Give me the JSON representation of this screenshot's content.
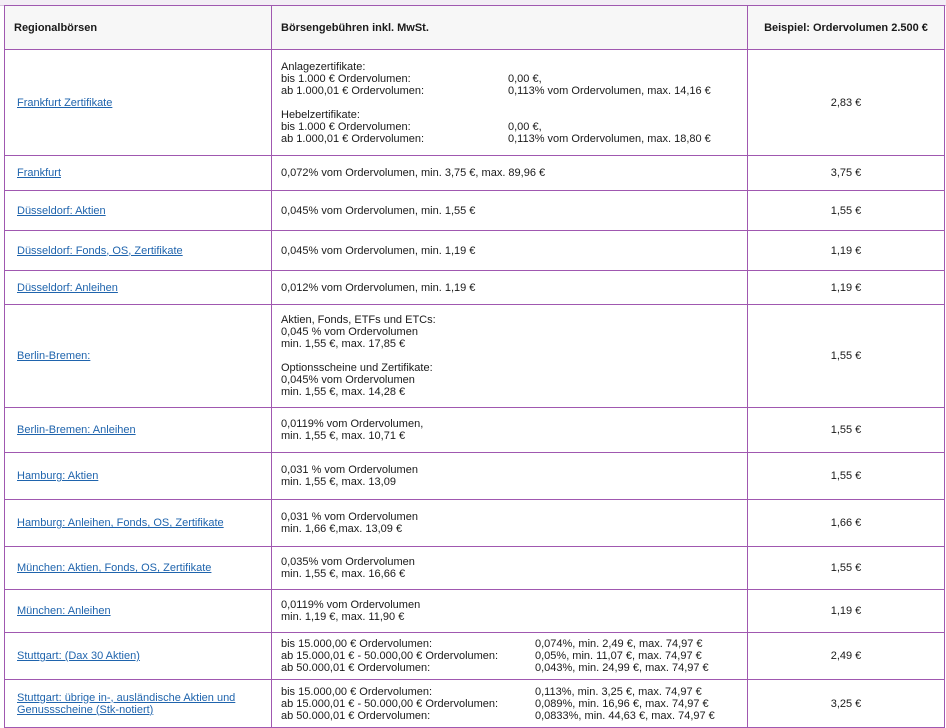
{
  "table": {
    "headers": [
      "Regionalbörsen",
      "Börsengebühren inkl. MwSt.",
      "Beispiel: Ordervolumen 2.500 €"
    ],
    "rows": [
      {
        "exchange": "Frankfurt Zertifikate",
        "fee": {
          "groups": [
            {
              "title": "Anlagezertifikate:",
              "lines": [
                [
                  "bis 1.000 € Ordervolumen:",
                  "0,00 €,"
                ],
                [
                  "ab 1.000,01 € Ordervolumen:",
                  "0,113% vom Ordervolumen, max. 14,16 €"
                ]
              ]
            },
            {
              "title": "Hebelzertifikate:",
              "lines": [
                [
                  "bis 1.000 € Ordervolumen:",
                  "0,00 €,"
                ],
                [
                  "ab 1.000,01 € Ordervolumen:",
                  "0,113% vom Ordervolumen, max. 18,80 €"
                ]
              ]
            }
          ]
        },
        "example": "2,83 €"
      },
      {
        "exchange": "Frankfurt",
        "fee": {
          "text": [
            "0,072% vom Ordervolumen, min. 3,75 €, max. 89,96 €"
          ]
        },
        "example": "3,75 €"
      },
      {
        "exchange": "Düsseldorf: Aktien",
        "fee": {
          "text": [
            "0,045% vom Ordervolumen, min. 1,55 €"
          ]
        },
        "example": "1,55 €"
      },
      {
        "exchange": "Düsseldorf: Fonds, OS, Zertifikate",
        "fee": {
          "text": [
            "0,045% vom Ordervolumen, min. 1,19 €"
          ]
        },
        "example": "1,19 €"
      },
      {
        "exchange": "Düsseldorf: Anleihen",
        "fee": {
          "text": [
            "0,012% vom Ordervolumen, min. 1,19 €"
          ]
        },
        "example": "1,19 €"
      },
      {
        "exchange": "Berlin-Bremen:",
        "fee": {
          "groups": [
            {
              "title": "Aktien, Fonds, ETFs und ETCs:",
              "text": [
                "0,045 % vom Ordervolumen",
                "min. 1,55 €, max. 17,85 €"
              ]
            },
            {
              "title": "Optionsscheine und Zertifikate:",
              "text": [
                "0,045% vom Ordervolumen",
                "min. 1,55 €, max. 14,28 €"
              ]
            }
          ]
        },
        "example": "1,55 €"
      },
      {
        "exchange": "Berlin-Bremen: Anleihen",
        "fee": {
          "text": [
            "0,0119% vom Ordervolumen,",
            "min. 1,55 €, max. 10,71 €"
          ]
        },
        "example": "1,55 €"
      },
      {
        "exchange": "Hamburg: Aktien",
        "fee": {
          "text": [
            "0,031 % vom Ordervolumen",
            "min. 1,55 €, max. 13,09"
          ]
        },
        "example": "1,55 €"
      },
      {
        "exchange": "Hamburg: Anleihen, Fonds, OS, Zertifikate",
        "fee": {
          "text": [
            "0,031 % vom Ordervolumen",
            "min. 1,66 €,max. 13,09 €"
          ]
        },
        "example": "1,66 €"
      },
      {
        "exchange": "München: Aktien, Fonds, OS, Zertifikate",
        "fee": {
          "text": [
            "0,035% vom Ordervolumen",
            "min. 1,55 €, max. 16,66 €"
          ]
        },
        "example": "1,55 €"
      },
      {
        "exchange": "München: Anleihen",
        "fee": {
          "text": [
            "0,0119% vom Ordervolumen",
            "min. 1,19 €, max. 11,90 €"
          ]
        },
        "example": "1,19 €"
      },
      {
        "exchange": "Stuttgart: (Dax 30 Aktien)",
        "fee": {
          "lines": [
            [
              "bis 15.000,00 € Ordervolumen:",
              "0,074%, min. 2,49 €, max. 74,97 €"
            ],
            [
              "ab 15.000,01 € - 50.000,00 € Ordervolumen:",
              "0,05%, min. 11,07 €, max. 74,97 €"
            ],
            [
              "ab 50.000,01 € Ordervolumen:",
              "0,043%, min. 24,99 €, max. 74,97 €"
            ]
          ]
        },
        "example": "2,49 €"
      },
      {
        "exchange": "Stuttgart: übrige in-, ausländische Aktien und Genussscheine (Stk-notiert)",
        "fee": {
          "lines": [
            [
              "bis 15.000,00 € Ordervolumen:",
              "0,113%, min. 3,25 €, max. 74,97 €"
            ],
            [
              "ab 15.000,01 € - 50.000,00 € Ordervolumen:",
              "0,089%, min. 16,96 €, max. 74,97 €"
            ],
            [
              "ab 50.000,01 € Ordervolumen:",
              "0,0833%, min. 44,63 €, max. 74,97 €"
            ]
          ]
        },
        "example": "3,25 €"
      }
    ]
  }
}
